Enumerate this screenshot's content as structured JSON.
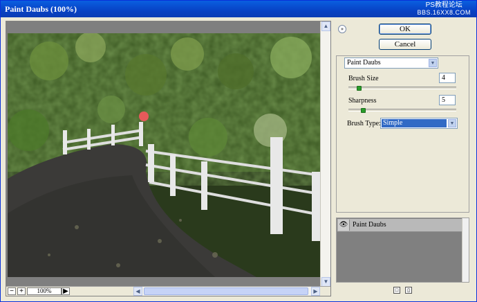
{
  "window": {
    "title": "Paint Daubs (100%)"
  },
  "watermark": {
    "line1": "PS教程论坛",
    "line2": "BBS.16XX8.COM"
  },
  "preview": {
    "zoom_out": "−",
    "zoom_in": "+",
    "zoom_value": "100%",
    "next": "▶"
  },
  "buttons": {
    "ok": "OK",
    "cancel": "Cancel"
  },
  "filter": {
    "selected": "Paint Daubs",
    "brush_size_label": "Brush Size",
    "brush_size_value": "4",
    "brush_size_fraction": 0.08,
    "sharpness_label": "Sharpness",
    "sharpness_value": "5",
    "sharpness_fraction": 0.12,
    "brush_type_label": "Brush Type:",
    "brush_type_value": "Simple"
  },
  "layers": {
    "items": [
      {
        "name": "Paint Daubs"
      }
    ]
  },
  "icons": {
    "collapse": "chevron-double-down-icon",
    "eye": "eye-icon",
    "new": "new-effect-layer-icon",
    "delete": "trash-icon"
  }
}
